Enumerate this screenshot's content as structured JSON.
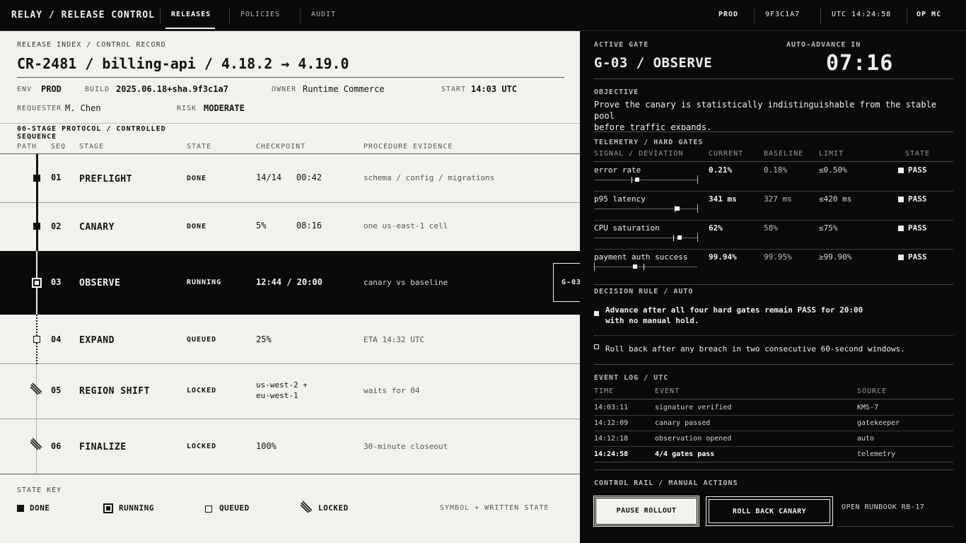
{
  "app": {
    "title": "RELAY / RELEASE CONTROL"
  },
  "nav": {
    "tabs": [
      {
        "label": "RELEASES"
      },
      {
        "label": "POLICIES"
      },
      {
        "label": "AUDIT"
      }
    ]
  },
  "topbar": {
    "env": "PROD",
    "sha": "9F3C1A7",
    "clock": "UTC 14:24:58",
    "operator": "OP MC"
  },
  "record": {
    "section_label": "RELEASE INDEX / CONTROL RECORD",
    "title": "CR-2481 / billing-api / 4.18.2 → 4.19.0",
    "env_label": "ENV",
    "env": "PROD",
    "build_label": "BUILD",
    "build": "2025.06.18+sha.9f3c1a7",
    "owner_label": "OWNER",
    "owner": "Runtime Commerce",
    "start_label": "START",
    "start": "14:03 UTC",
    "requester_label": "REQUESTER",
    "requester": "M. Chen",
    "risk_label": "RISK",
    "risk": "MODERATE"
  },
  "protocol": {
    "label_line1": "06-STAGE PROTOCOL / CONTROLLED",
    "label_line2": "SEQUENCE",
    "columns": [
      "PATH",
      "SEQ",
      "STAGE",
      "STATE",
      "CHECKPOINT",
      "PROCEDURE EVIDENCE"
    ],
    "stages": [
      {
        "seq": "01",
        "stage": "PREFLIGHT",
        "state": "DONE",
        "checkpoint": "14/14",
        "checkpoint2": "00:42",
        "evidence": "schema / config / migrations"
      },
      {
        "seq": "02",
        "stage": "CANARY",
        "state": "DONE",
        "checkpoint": "5%",
        "checkpoint2": "08:16",
        "evidence": "one us-east-1 cell"
      },
      {
        "seq": "03",
        "stage": "OBSERVE",
        "state": "RUNNING",
        "checkpoint": "12:44 / 20:00",
        "checkpoint2": "",
        "evidence": "canary vs baseline"
      },
      {
        "seq": "04",
        "stage": "EXPAND",
        "state": "QUEUED",
        "checkpoint": "25%",
        "checkpoint2": "",
        "evidence": "ETA 14:32 UTC"
      },
      {
        "seq": "05",
        "stage": "REGION SHIFT",
        "state": "LOCKED",
        "checkpoint": "us-west-2 +",
        "checkpoint2": "eu-west-1",
        "evidence": "waits for 04"
      },
      {
        "seq": "06",
        "stage": "FINALIZE",
        "state": "LOCKED",
        "checkpoint": "100%",
        "checkpoint2": "",
        "evidence": "30-minute closeout"
      }
    ],
    "gate_tag": "G-03"
  },
  "state_key": {
    "label": "STATE KEY",
    "items": [
      "DONE",
      "RUNNING",
      "QUEUED",
      "LOCKED"
    ],
    "note": "SYMBOL + WRITTEN STATE"
  },
  "gate": {
    "label": "ACTIVE GATE",
    "title": "G-03 / OBSERVE",
    "auto_label": "AUTO-ADVANCE IN",
    "countdown": "07:16",
    "objective_label": "OBJECTIVE",
    "objective_line1": "Prove the canary is statistically indistinguishable from the stable pool",
    "objective_line2": "before traffic expands."
  },
  "telemetry": {
    "label": "TELEMETRY / HARD GATES",
    "columns": [
      "SIGNAL / DEVIATION",
      "CURRENT",
      "BASELINE",
      "LIMIT",
      "STATE"
    ],
    "rows": [
      {
        "signal": "error rate",
        "current": "0.21%",
        "baseline": "0.18%",
        "limit": "≤0.50%",
        "state": "PASS",
        "current_frac": 0.42,
        "baseline_frac": 0.36
      },
      {
        "signal": "p95 latency",
        "current": "341 ms",
        "baseline": "327 ms",
        "limit": "≤420 ms",
        "state": "PASS",
        "current_frac": 0.81,
        "baseline_frac": 0.78
      },
      {
        "signal": "CPU saturation",
        "current": "62%",
        "baseline": "58%",
        "limit": "≤75%",
        "state": "PASS",
        "current_frac": 0.83,
        "baseline_frac": 0.77
      },
      {
        "signal": "payment auth success",
        "current": "99.94%",
        "baseline": "99.95%",
        "limit": "≥99.90%",
        "state": "PASS",
        "current_frac": 0.4,
        "baseline_frac": 0.48
      }
    ]
  },
  "decision": {
    "label": "DECISION RULE / AUTO",
    "rule1_line1": "Advance after all four hard gates remain PASS for 20:00",
    "rule1_line2": "with no manual hold.",
    "rule2": "Roll back after any breach in two consecutive 60-second windows."
  },
  "events": {
    "label": "EVENT LOG / UTC",
    "columns": [
      "TIME",
      "EVENT",
      "SOURCE"
    ],
    "rows": [
      {
        "time": "14:03:11",
        "event": "signature verified",
        "source": "KMS-7"
      },
      {
        "time": "14:12:09",
        "event": "canary passed",
        "source": "gatekeeper"
      },
      {
        "time": "14:12:18",
        "event": "observation opened",
        "source": "auto"
      },
      {
        "time": "14:24:58",
        "event": "4/4 gates pass",
        "source": "telemetry"
      }
    ]
  },
  "actions": {
    "label": "CONTROL RAIL / MANUAL ACTIONS",
    "pause": "PAUSE ROLLOUT",
    "rollback": "ROLL BACK CANARY",
    "runbook": "OPEN RUNBOOK RB-17"
  }
}
